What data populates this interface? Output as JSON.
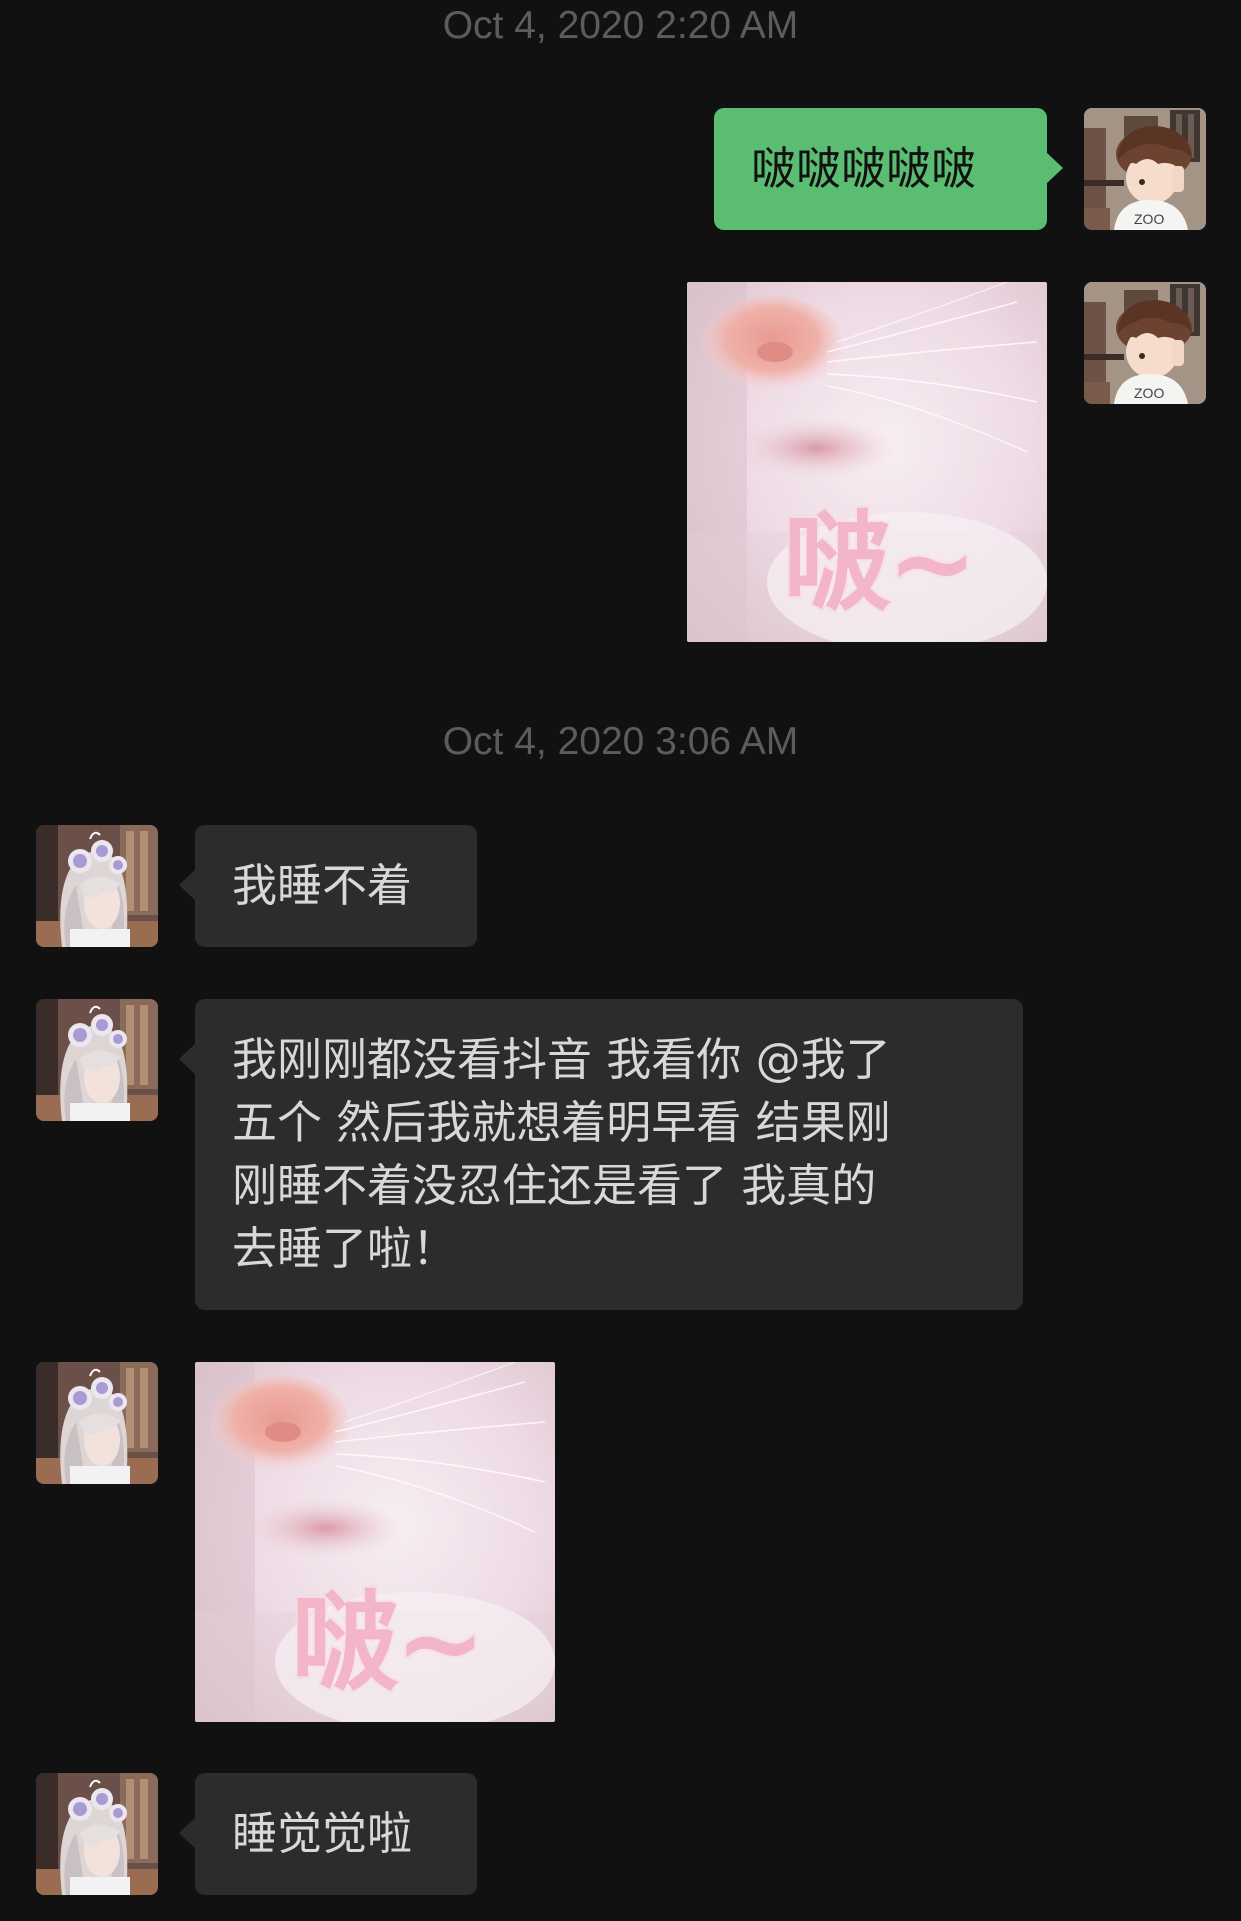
{
  "colors": {
    "background": "#111111",
    "outgoing_bubble": "#5bbd72",
    "incoming_bubble": "#2c2c2c",
    "timestamp_text": "#5c5c5c"
  },
  "conversation": {
    "timestamps": [
      "Oct 4, 2020 2:20 AM",
      "Oct 4, 2020 3:06 AM"
    ],
    "messages": [
      {
        "sender": "me",
        "type": "text",
        "text": "啵啵啵啵啵",
        "avatar": "boy-anime-avatar"
      },
      {
        "sender": "me",
        "type": "sticker",
        "sticker_caption": "啵~",
        "sticker": "pink-nose-cat-sticker",
        "avatar": "boy-anime-avatar"
      },
      {
        "sender": "other",
        "type": "text",
        "text": "我睡不着",
        "avatar": "girl-anime-avatar"
      },
      {
        "sender": "other",
        "type": "text",
        "text": "我刚刚都没看抖音 我看你 @我了\n五个 然后我就想着明早看 结果刚\n刚睡不着没忍住还是看了 我真的\n去睡了啦！",
        "avatar": "girl-anime-avatar"
      },
      {
        "sender": "other",
        "type": "sticker",
        "sticker_caption": "啵~",
        "sticker": "pink-nose-cat-sticker",
        "avatar": "girl-anime-avatar"
      },
      {
        "sender": "other",
        "type": "text",
        "text": "睡觉觉啦",
        "avatar": "girl-anime-avatar"
      }
    ]
  }
}
